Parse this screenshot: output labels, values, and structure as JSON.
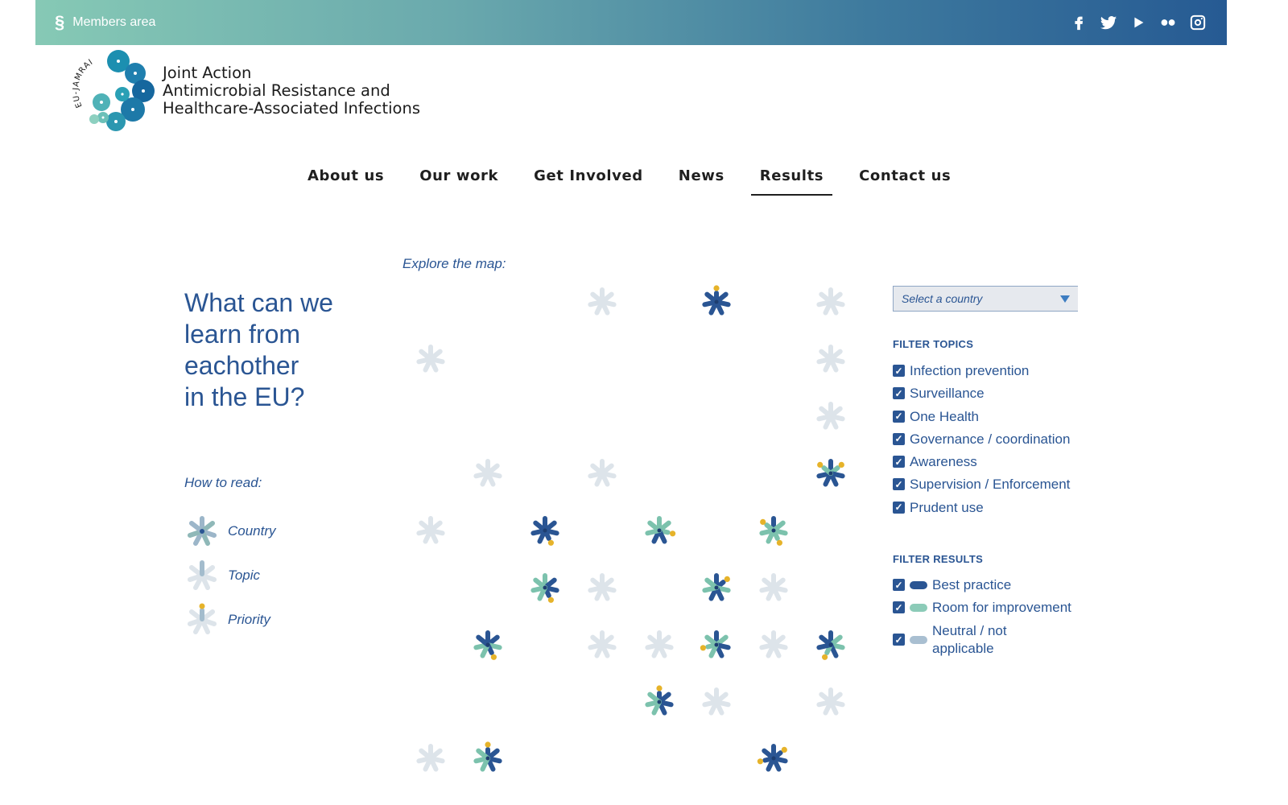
{
  "topbar": {
    "members_label": "Members area",
    "social_icons": [
      "facebook-icon",
      "twitter-icon",
      "youtube-icon",
      "flickr-icon",
      "instagram-icon"
    ]
  },
  "logo": {
    "ring_text": "EU-JAMRAI",
    "line1": "Joint Action",
    "line2": "Antimicrobial Resistance and",
    "line3": "Healthcare-Associated Infections"
  },
  "nav": {
    "items": [
      {
        "label": "About us"
      },
      {
        "label": "Our work"
      },
      {
        "label": "Get Involved"
      },
      {
        "label": "News"
      },
      {
        "label": "Results",
        "active": true
      },
      {
        "label": "Contact us"
      }
    ]
  },
  "headline": {
    "line1": "What can we",
    "line2": "learn from",
    "line3": "eachother",
    "line4": "in the EU?"
  },
  "howto": {
    "title": "How to read:",
    "country": "Country",
    "topic": "Topic",
    "priority": "Priority"
  },
  "map": {
    "explore_label": "Explore the map:"
  },
  "panel": {
    "select_placeholder": "Select a country",
    "filter_topics_title": "FILTER TOPICS",
    "topics": [
      "Infection prevention",
      "Surveillance",
      "One Health",
      "Governance / coordination",
      "Awareness",
      "Supervision / Enforcement",
      "Prudent use"
    ],
    "filter_results_title": "FILTER RESULTS",
    "results": [
      {
        "label": "Best practice",
        "color": "#2a5593"
      },
      {
        "label": "Room for improvement",
        "color": "#8ccbb8"
      },
      {
        "label": "Neutral / not applicable",
        "color": "#a9bfd1"
      }
    ]
  },
  "colors": {
    "brand_blue": "#2a5593",
    "best": "#2a5593",
    "improve": "#7cc2ad",
    "neutral": "#a3bccd",
    "empty": "#dde4ea",
    "priority": "#e6b32a"
  }
}
